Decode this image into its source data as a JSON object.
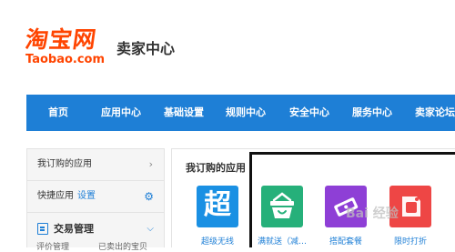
{
  "brand": {
    "logo_cn": "淘宝网",
    "logo_en": "Taobao.com",
    "site_title": "卖家中心"
  },
  "nav": {
    "items": [
      "首页",
      "应用中心",
      "基础设置",
      "规则中心",
      "安全中心",
      "服务中心",
      "卖家论坛"
    ]
  },
  "sidebar": {
    "subscribed_label": "我订购的应用",
    "quick_label": "快捷应用",
    "quick_setting": "设置",
    "section_title": "交易管理",
    "sub_items": [
      "评价管理",
      "已卖出的宝贝"
    ]
  },
  "main": {
    "title": "我订购的应用",
    "apps": [
      {
        "label": "超级无线",
        "icon": "chao-icon",
        "color": "#1a90e3",
        "glyph": "超"
      },
      {
        "label": "满就送（减…",
        "icon": "basket-icon",
        "color": "#26b07a"
      },
      {
        "label": "搭配套餐",
        "icon": "package-icon",
        "color": "#8e3fd6"
      },
      {
        "label": "限时打折",
        "icon": "discount-tag-icon",
        "color": "#ee4645"
      }
    ]
  },
  "watermark": "Bai 经验",
  "colors": {
    "brand": "#ff4400",
    "nav": "#1e7fd6",
    "link": "#1e7fd6"
  }
}
